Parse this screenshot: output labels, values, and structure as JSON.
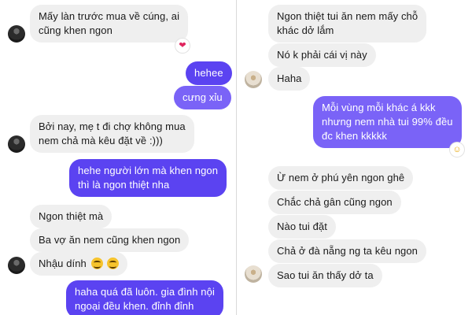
{
  "left_panel": {
    "messages": [
      {
        "side": "in",
        "lines": [
          "Mấy làn trước mua về cúng, ai",
          "cũng khen ngon"
        ]
      },
      {
        "side": "out",
        "text": "hehee"
      },
      {
        "side": "out",
        "text": "cưng xỉu"
      },
      {
        "side": "in",
        "lines": [
          "Bởi nay, mẹ t đi chợ không mua",
          "nem chả mà kêu đặt về :)))"
        ]
      },
      {
        "side": "out",
        "lines": [
          "hehe người lớn mà khen ngon",
          "thì là ngon thiệt nha"
        ]
      },
      {
        "side": "in",
        "text": "Ngon thiệt mà"
      },
      {
        "side": "in",
        "text": "Ba vợ ăn nem cũng khen ngon"
      },
      {
        "side": "in",
        "text": "Nhậu dính"
      },
      {
        "side": "out",
        "lines": [
          "haha quá đã luôn. gia đình nội",
          "ngoại đều khen. đỉnh đỉnh"
        ]
      }
    ],
    "reactions": {
      "first_message": "heart-icon"
    }
  },
  "right_panel": {
    "messages": [
      {
        "side": "in",
        "lines": [
          "Ngon thiệt tui ăn nem mấy chỗ",
          "khác dở lắm"
        ]
      },
      {
        "side": "in",
        "text": "Nó k phải cái vị này"
      },
      {
        "side": "in",
        "text": "Haha"
      },
      {
        "side": "out",
        "lines": [
          "Mỗi vùng mỗi khác á kkk",
          "nhưng nem nhà tui 99% đều",
          "đc khen kkkkk"
        ]
      },
      {
        "side": "in",
        "text": "Ừ nem ở phú yên ngon ghê"
      },
      {
        "side": "in",
        "text": "Chắc chả gân cũng ngon"
      },
      {
        "side": "in",
        "text": "Nào tui đặt"
      },
      {
        "side": "in",
        "text": "Chả ở đà nẵng ng ta kêu ngon"
      },
      {
        "side": "in",
        "text": "Sao tui ăn thấy dở ta"
      }
    ],
    "reactions": {
      "out_message": "smile-icon"
    }
  },
  "colors": {
    "outgoing": "#5b43f1",
    "incoming": "#efefef",
    "heart": "#e0245e"
  }
}
